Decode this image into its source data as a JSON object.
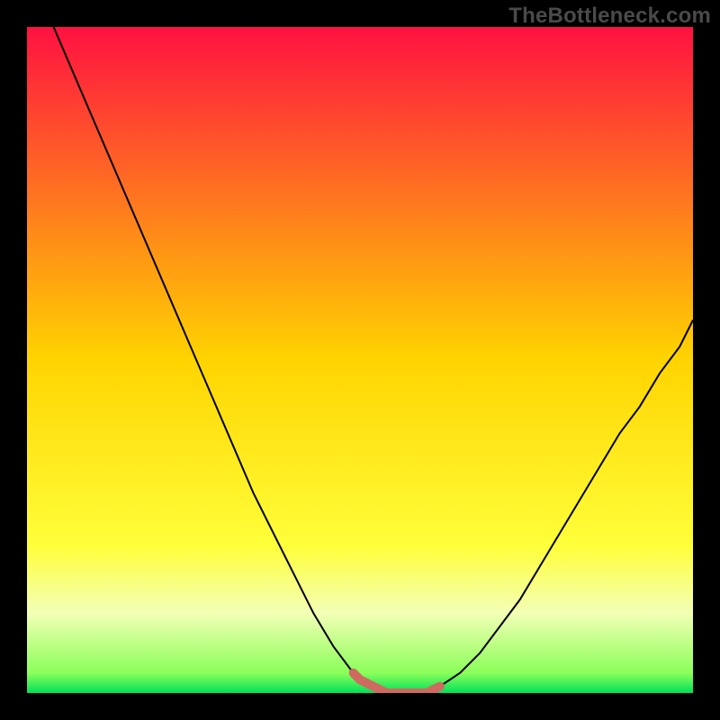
{
  "watermark": "TheBottleneck.com",
  "chart_data": {
    "type": "line",
    "title": "",
    "xlabel": "",
    "ylabel": "",
    "xlim": [
      0,
      100
    ],
    "ylim": [
      0,
      100
    ],
    "grid": false,
    "legend": false,
    "gradient_stops": [
      {
        "offset": 0.0,
        "color": "#ff1141"
      },
      {
        "offset": 0.5,
        "color": "#ffd400"
      },
      {
        "offset": 0.78,
        "color": "#ffff3a"
      },
      {
        "offset": 0.88,
        "color": "#f3ffb6"
      },
      {
        "offset": 0.97,
        "color": "#8bff5a"
      },
      {
        "offset": 1.0,
        "color": "#00e05a"
      }
    ],
    "series": [
      {
        "name": "curve",
        "color": "#000000",
        "width": 2.0,
        "x": [
          4,
          7,
          10,
          13,
          16,
          19,
          22,
          25,
          28,
          31,
          34,
          37,
          40,
          43,
          46,
          49,
          50,
          52,
          54,
          56,
          58,
          60,
          62,
          65,
          68,
          71,
          74,
          77,
          80,
          83,
          86,
          89,
          92,
          95,
          98,
          100
        ],
        "y": [
          100,
          93,
          86,
          79,
          72,
          65,
          58,
          51,
          44,
          37,
          30,
          24,
          18,
          12,
          7,
          3,
          2,
          1,
          0,
          0,
          0,
          0,
          1,
          3,
          6,
          10,
          14,
          19,
          24,
          29,
          34,
          39,
          43,
          48,
          52,
          56
        ]
      },
      {
        "name": "bottom-mark",
        "color": "#cf6a60",
        "width": 10.0,
        "linecap": "round",
        "x": [
          49,
          50,
          52,
          54,
          56,
          58,
          60,
          62
        ],
        "y": [
          3,
          2,
          1,
          0,
          0,
          0,
          0,
          1
        ]
      }
    ]
  }
}
